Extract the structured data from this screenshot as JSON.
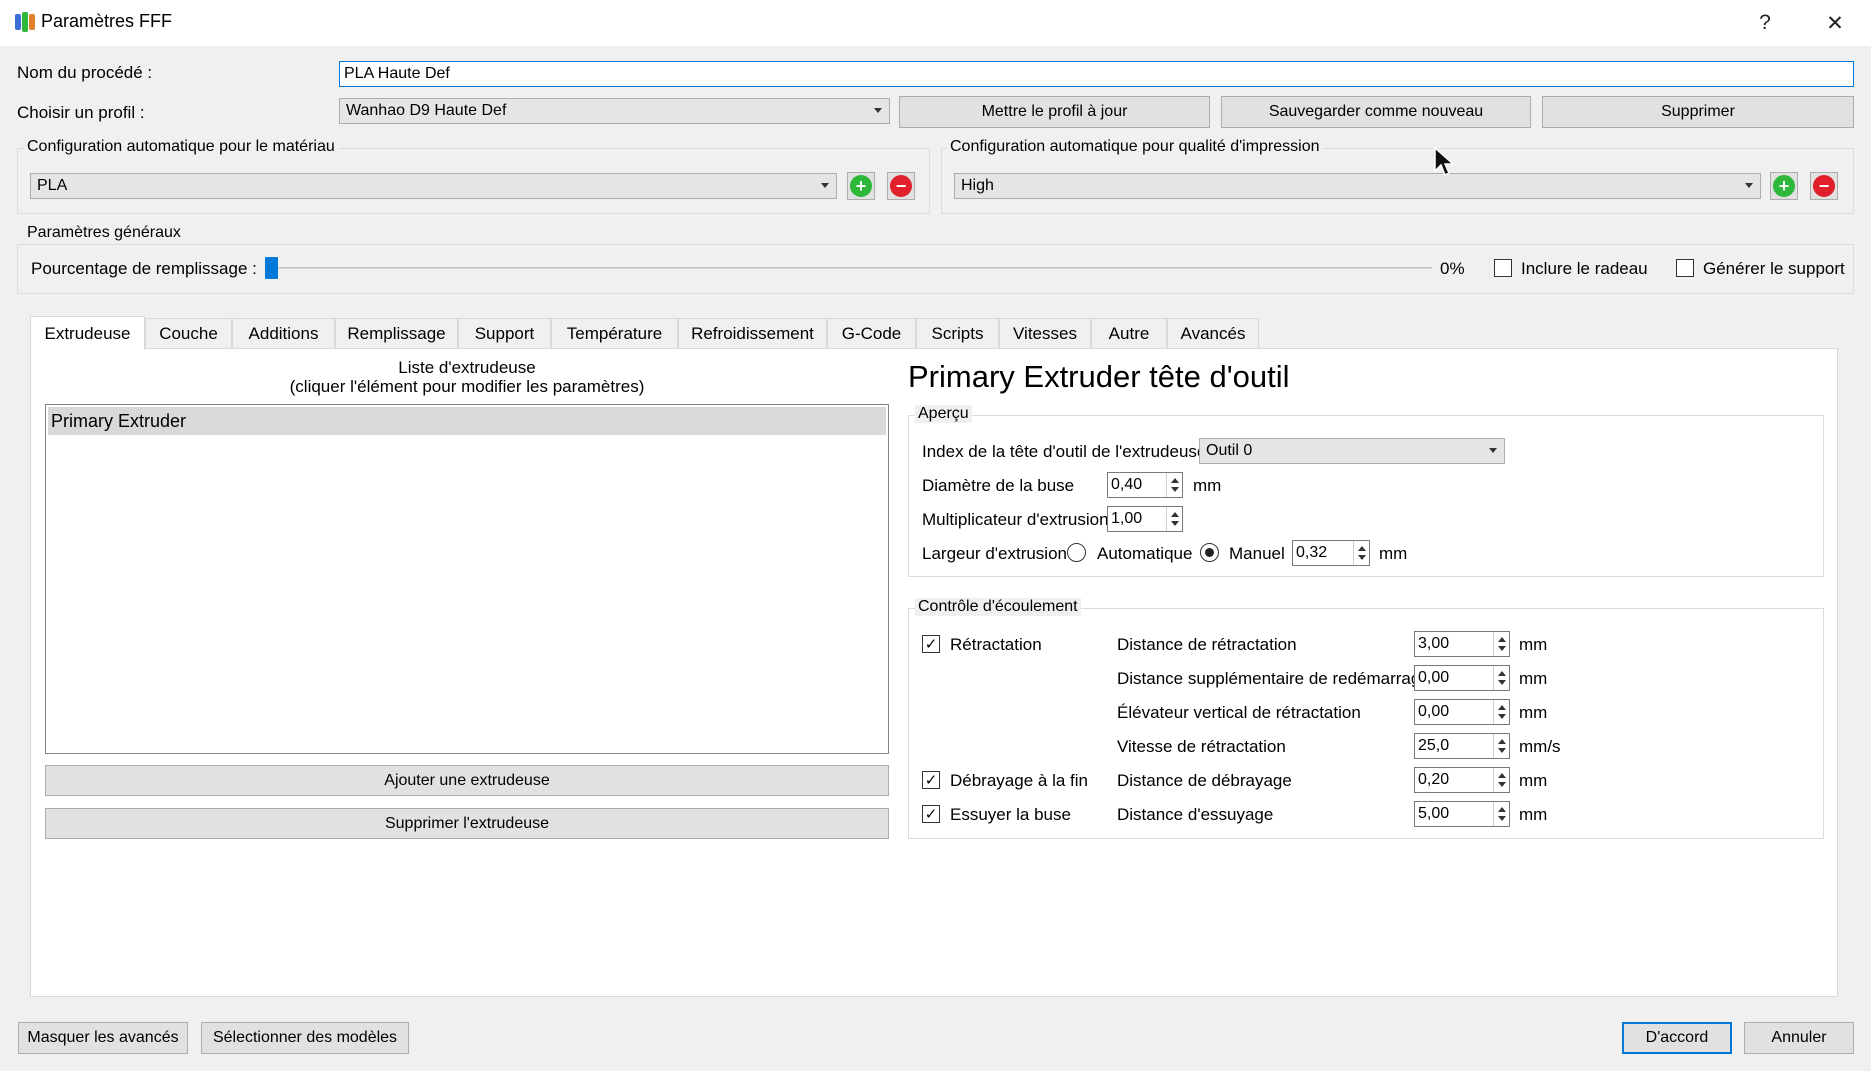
{
  "window": {
    "title": "Paramètres FFF",
    "help_glyph": "?",
    "close_glyph": "✕"
  },
  "process": {
    "name_label": "Nom du procédé :",
    "name_value": "PLA Haute Def",
    "profile_label": "Choisir un profil :",
    "profile_value": "Wanhao D9 Haute Def",
    "update_button": "Mettre le profil à jour",
    "save_new_button": "Sauvegarder comme nouveau",
    "delete_button": "Supprimer"
  },
  "auto_material": {
    "title": "Configuration automatique pour le matériau",
    "value": "PLA"
  },
  "auto_quality": {
    "title": "Configuration automatique pour qualité d'impression",
    "value": "High"
  },
  "general": {
    "title": "Paramètres généraux",
    "infill_label": "Pourcentage de remplissage :",
    "infill_value": 0,
    "infill_display": "0%",
    "raft_label": "Inclure le radeau",
    "raft_checked": false,
    "support_label": "Générer le support",
    "support_checked": false
  },
  "tabs": [
    {
      "label": "Extrudeuse",
      "active": true
    },
    {
      "label": "Couche"
    },
    {
      "label": "Additions"
    },
    {
      "label": "Remplissage"
    },
    {
      "label": "Support"
    },
    {
      "label": "Température"
    },
    {
      "label": "Refroidissement"
    },
    {
      "label": "G-Code"
    },
    {
      "label": "Scripts"
    },
    {
      "label": "Vitesses"
    },
    {
      "label": "Autre"
    },
    {
      "label": "Avancés"
    }
  ],
  "extruder_list": {
    "header_line1": "Liste d'extrudeuse",
    "header_line2": "(cliquer l'élément pour modifier les paramètres)",
    "items": [
      "Primary Extruder"
    ],
    "add_button": "Ajouter une extrudeuse",
    "remove_button": "Supprimer l'extrudeuse"
  },
  "extruder_detail": {
    "title": "Primary Extruder tête d'outil",
    "overview": {
      "title": "Aperçu",
      "index_label": "Index de la tête d'outil de l'extrudeuse",
      "index_value": "Outil 0",
      "nozzle_label": "Diamètre de la buse",
      "nozzle_value": "0,40",
      "nozzle_unit": "mm",
      "mult_label": "Multiplicateur d'extrusion",
      "mult_value": "1,00",
      "width_label": "Largeur d'extrusion",
      "auto_label": "Automatique",
      "manual_label": "Manuel",
      "width_mode": "manual",
      "width_value": "0,32",
      "width_unit": "mm"
    },
    "flow": {
      "title": "Contrôle d'écoulement",
      "retraction_label": "Rétractation",
      "retraction_checked": true,
      "coast_label": "Débrayage à la fin",
      "coast_checked": true,
      "wipe_label": "Essuyer la buse",
      "wipe_checked": true,
      "rows": [
        {
          "label": "Distance de rétractation",
          "value": "3,00",
          "unit": "mm"
        },
        {
          "label": "Distance supplémentaire de redémarrage",
          "value": "0,00",
          "unit": "mm"
        },
        {
          "label": "Élévateur vertical de rétractation",
          "value": "0,00",
          "unit": "mm"
        },
        {
          "label": "Vitesse de rétractation",
          "value": "25,0",
          "unit": "mm/s"
        },
        {
          "label": "Distance de débrayage",
          "value": "0,20",
          "unit": "mm"
        },
        {
          "label": "Distance d'essuyage",
          "value": "5,00",
          "unit": "mm"
        }
      ]
    }
  },
  "footer": {
    "hide_advanced_button": "Masquer les avancés",
    "select_models_button": "Sélectionner des modèles",
    "ok_button": "D'accord",
    "cancel_button": "Annuler"
  },
  "colors": {
    "accent": "#0078d7",
    "add": "#2eb83a",
    "remove": "#e0202b"
  }
}
